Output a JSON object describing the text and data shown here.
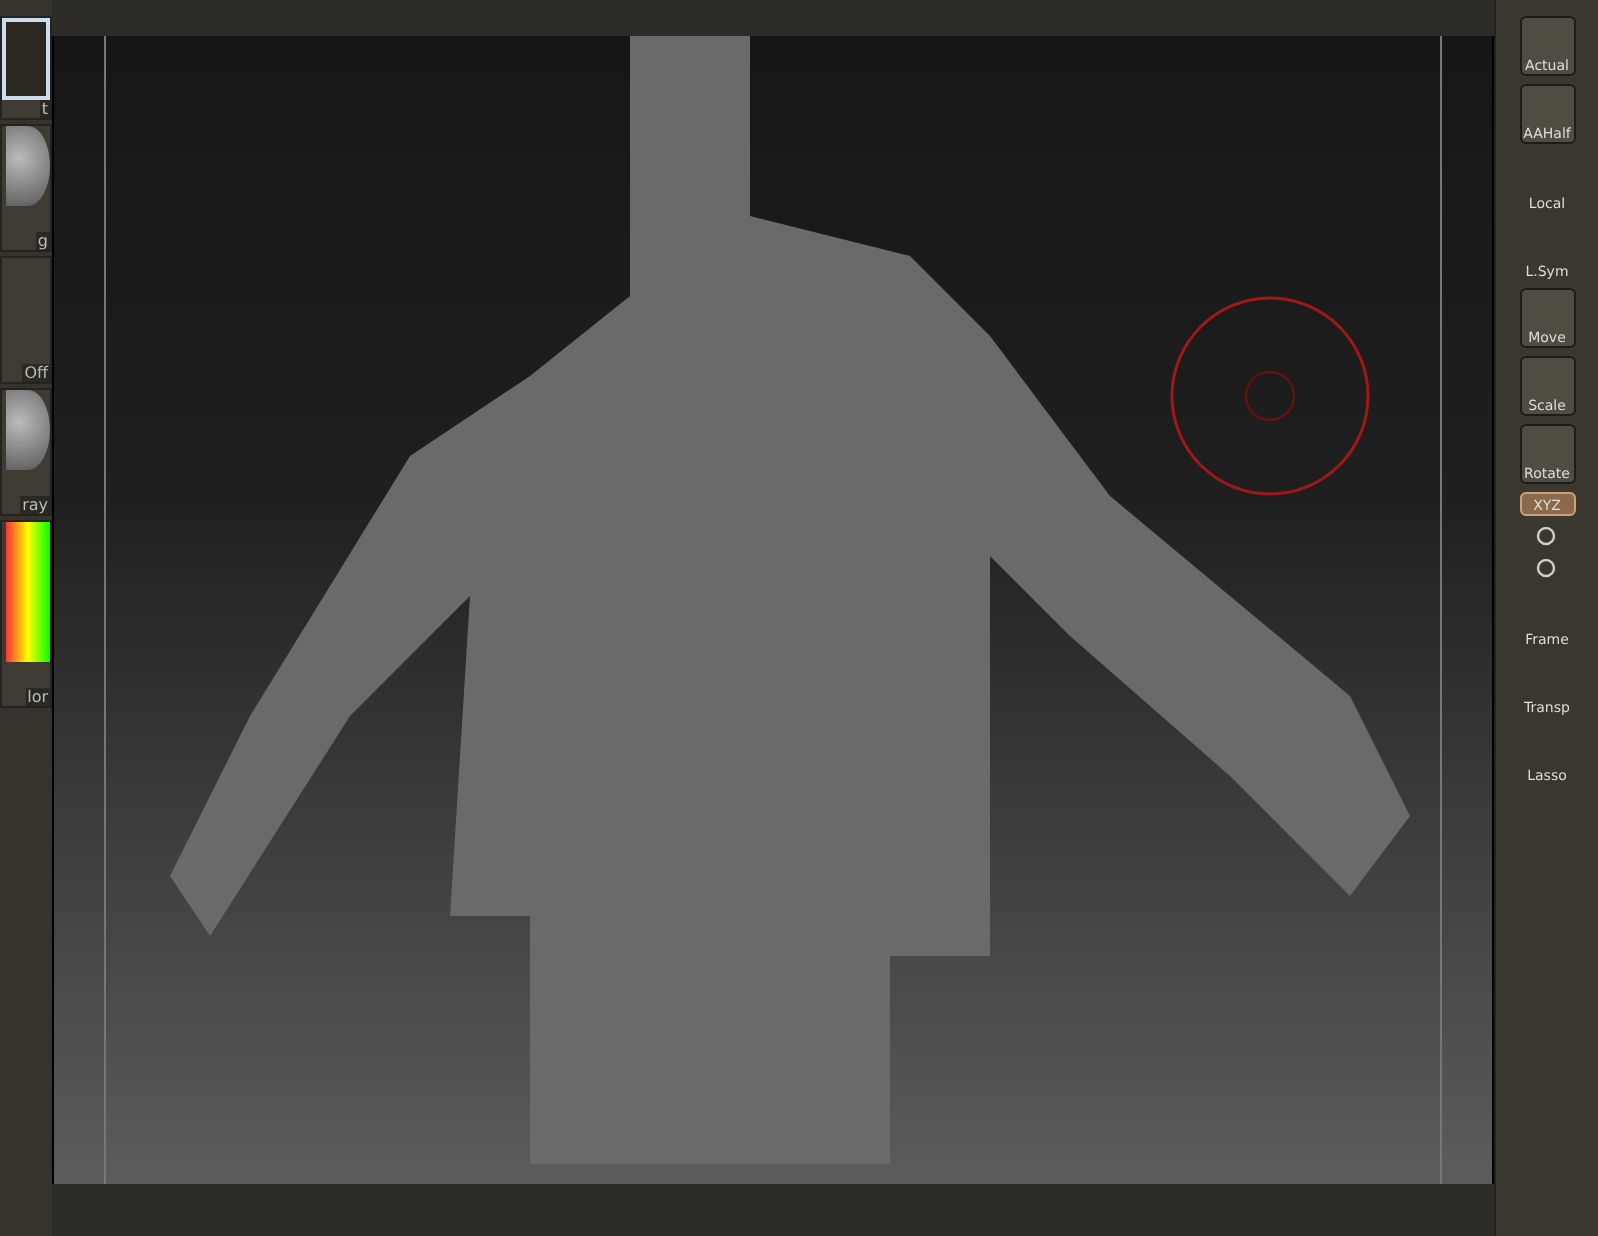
{
  "left_tray": [
    {
      "kind": "swatch",
      "label": "t"
    },
    {
      "kind": "sphere",
      "label": "g"
    },
    {
      "kind": "blank",
      "label": "Off"
    },
    {
      "kind": "sphere",
      "label": "ray"
    },
    {
      "kind": "color",
      "label": "lor"
    }
  ],
  "right_tray": [
    {
      "kind": "framed",
      "label": "Actual",
      "selected": false
    },
    {
      "kind": "framed",
      "label": "AAHalf",
      "selected": false
    },
    {
      "kind": "plain",
      "label": "Local",
      "selected": false
    },
    {
      "kind": "plain",
      "label": "L.Sym",
      "selected": false
    },
    {
      "kind": "framed",
      "label": "Move",
      "selected": false
    },
    {
      "kind": "framed",
      "label": "Scale",
      "selected": false
    },
    {
      "kind": "framed",
      "label": "Rotate",
      "selected": false
    },
    {
      "kind": "pill",
      "label": "XYZ",
      "selected": true
    },
    {
      "kind": "icon"
    },
    {
      "kind": "icon"
    },
    {
      "kind": "plain",
      "label": "Frame",
      "selected": false
    },
    {
      "kind": "plain",
      "label": "Transp",
      "selected": false
    },
    {
      "kind": "plain",
      "label": "Lasso",
      "selected": false
    }
  ]
}
